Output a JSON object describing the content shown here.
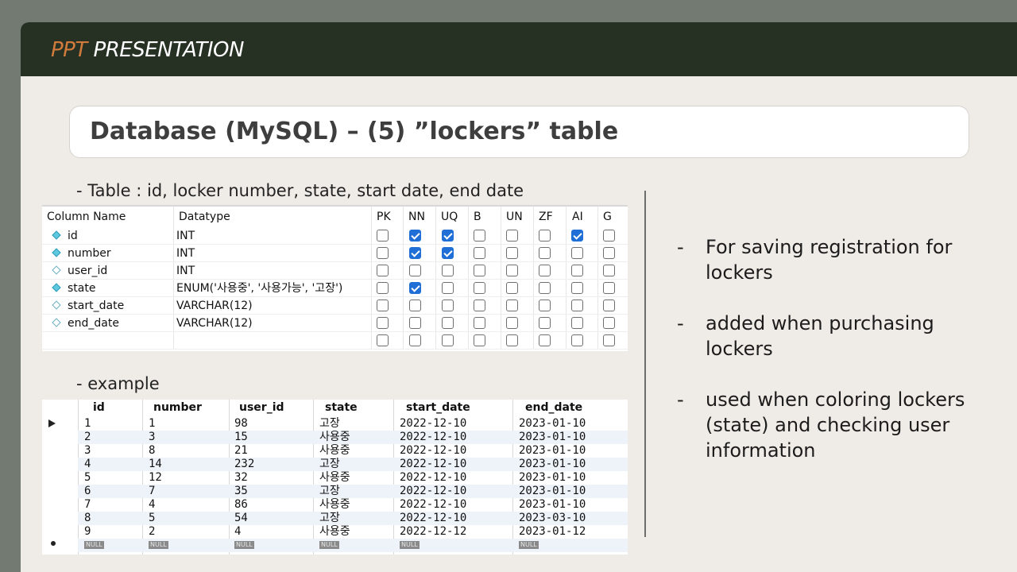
{
  "header": {
    "accent": "PPT",
    "title": "PRESENTATION"
  },
  "slide_title": "Database (MySQL) – (5) ”lockers” table",
  "schema_caption": "- Table : id, locker number, state, start date, end date",
  "schema": {
    "headers": [
      "Column Name",
      "Datatype",
      "PK",
      "NN",
      "UQ",
      "B",
      "UN",
      "ZF",
      "AI",
      "G"
    ],
    "rows": [
      {
        "name": "id",
        "type": "INT",
        "pk_icon": true,
        "flags": [
          false,
          true,
          true,
          false,
          false,
          false,
          true,
          false
        ]
      },
      {
        "name": "number",
        "type": "INT",
        "pk_icon": true,
        "flags": [
          false,
          true,
          true,
          false,
          false,
          false,
          false,
          false
        ]
      },
      {
        "name": "user_id",
        "type": "INT",
        "pk_icon": false,
        "flags": [
          false,
          false,
          false,
          false,
          false,
          false,
          false,
          false
        ]
      },
      {
        "name": "state",
        "type": "ENUM('사용중', '사용가능', '고장')",
        "pk_icon": true,
        "flags": [
          false,
          true,
          false,
          false,
          false,
          false,
          false,
          false
        ]
      },
      {
        "name": "start_date",
        "type": "VARCHAR(12)",
        "pk_icon": false,
        "flags": [
          false,
          false,
          false,
          false,
          false,
          false,
          false,
          false
        ]
      },
      {
        "name": "end_date",
        "type": "VARCHAR(12)",
        "pk_icon": false,
        "flags": [
          false,
          false,
          false,
          false,
          false,
          false,
          false,
          false
        ]
      },
      {
        "name": "",
        "type": "",
        "pk_icon": null,
        "flags": [
          false,
          false,
          false,
          false,
          false,
          false,
          false,
          false
        ]
      }
    ]
  },
  "example_caption": "- example",
  "example": {
    "headers": [
      "id",
      "number",
      "user_id",
      "state",
      "start_date",
      "end_date"
    ],
    "rows": [
      [
        "1",
        "1",
        "98",
        "고장",
        "2022-12-10",
        "2023-01-10"
      ],
      [
        "2",
        "3",
        "15",
        "사용중",
        "2022-12-10",
        "2023-01-10"
      ],
      [
        "3",
        "8",
        "21",
        "사용중",
        "2022-12-10",
        "2023-01-10"
      ],
      [
        "4",
        "14",
        "232",
        "고장",
        "2022-12-10",
        "2023-01-10"
      ],
      [
        "5",
        "12",
        "32",
        "사용중",
        "2022-12-10",
        "2023-01-10"
      ],
      [
        "6",
        "7",
        "35",
        "고장",
        "2022-12-10",
        "2023-01-10"
      ],
      [
        "7",
        "4",
        "86",
        "사용중",
        "2022-12-10",
        "2023-01-10"
      ],
      [
        "8",
        "5",
        "54",
        "고장",
        "2022-12-10",
        "2023-03-10"
      ],
      [
        "9",
        "2",
        "4",
        "사용중",
        "2022-12-12",
        "2023-01-12"
      ]
    ],
    "null_label": "NULL"
  },
  "bullets": [
    "For saving registration for lockers",
    "added when purchasing lockers",
    "used when coloring lockers (state) and checking user information"
  ],
  "colors": {
    "header_bg": "#263124",
    "accent": "#d07a3c",
    "checkbox_on": "#1f6fd6"
  }
}
